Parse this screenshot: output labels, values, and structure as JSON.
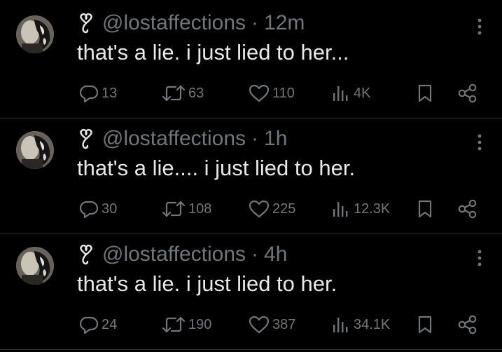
{
  "colors": {
    "background": "#000000",
    "primary_text": "#e7e9ea",
    "secondary_text": "#71767b",
    "divider": "#2f3336"
  },
  "icons": {
    "badge": "infinity-knot-badge-icon",
    "more": "more-vertical-icon",
    "reply": "reply-icon",
    "repost": "repost-icon",
    "like": "heart-icon",
    "views": "views-bar-chart-icon",
    "bookmark": "bookmark-icon",
    "share": "share-icon"
  },
  "tweets": [
    {
      "handle": "@lostaffections",
      "separator": "·",
      "time": "12m",
      "text": "that's a lie. i just lied to her...",
      "replies": "13",
      "reposts": "63",
      "likes": "110",
      "views": "4K"
    },
    {
      "handle": "@lostaffections",
      "separator": "·",
      "time": "1h",
      "text": "that's a lie.... i just lied to her.",
      "replies": "30",
      "reposts": "108",
      "likes": "225",
      "views": "12.3K"
    },
    {
      "handle": "@lostaffections",
      "separator": "·",
      "time": "4h",
      "text": "that's a lie. i just lied to her.",
      "replies": "24",
      "reposts": "190",
      "likes": "387",
      "views": "34.1K"
    }
  ]
}
